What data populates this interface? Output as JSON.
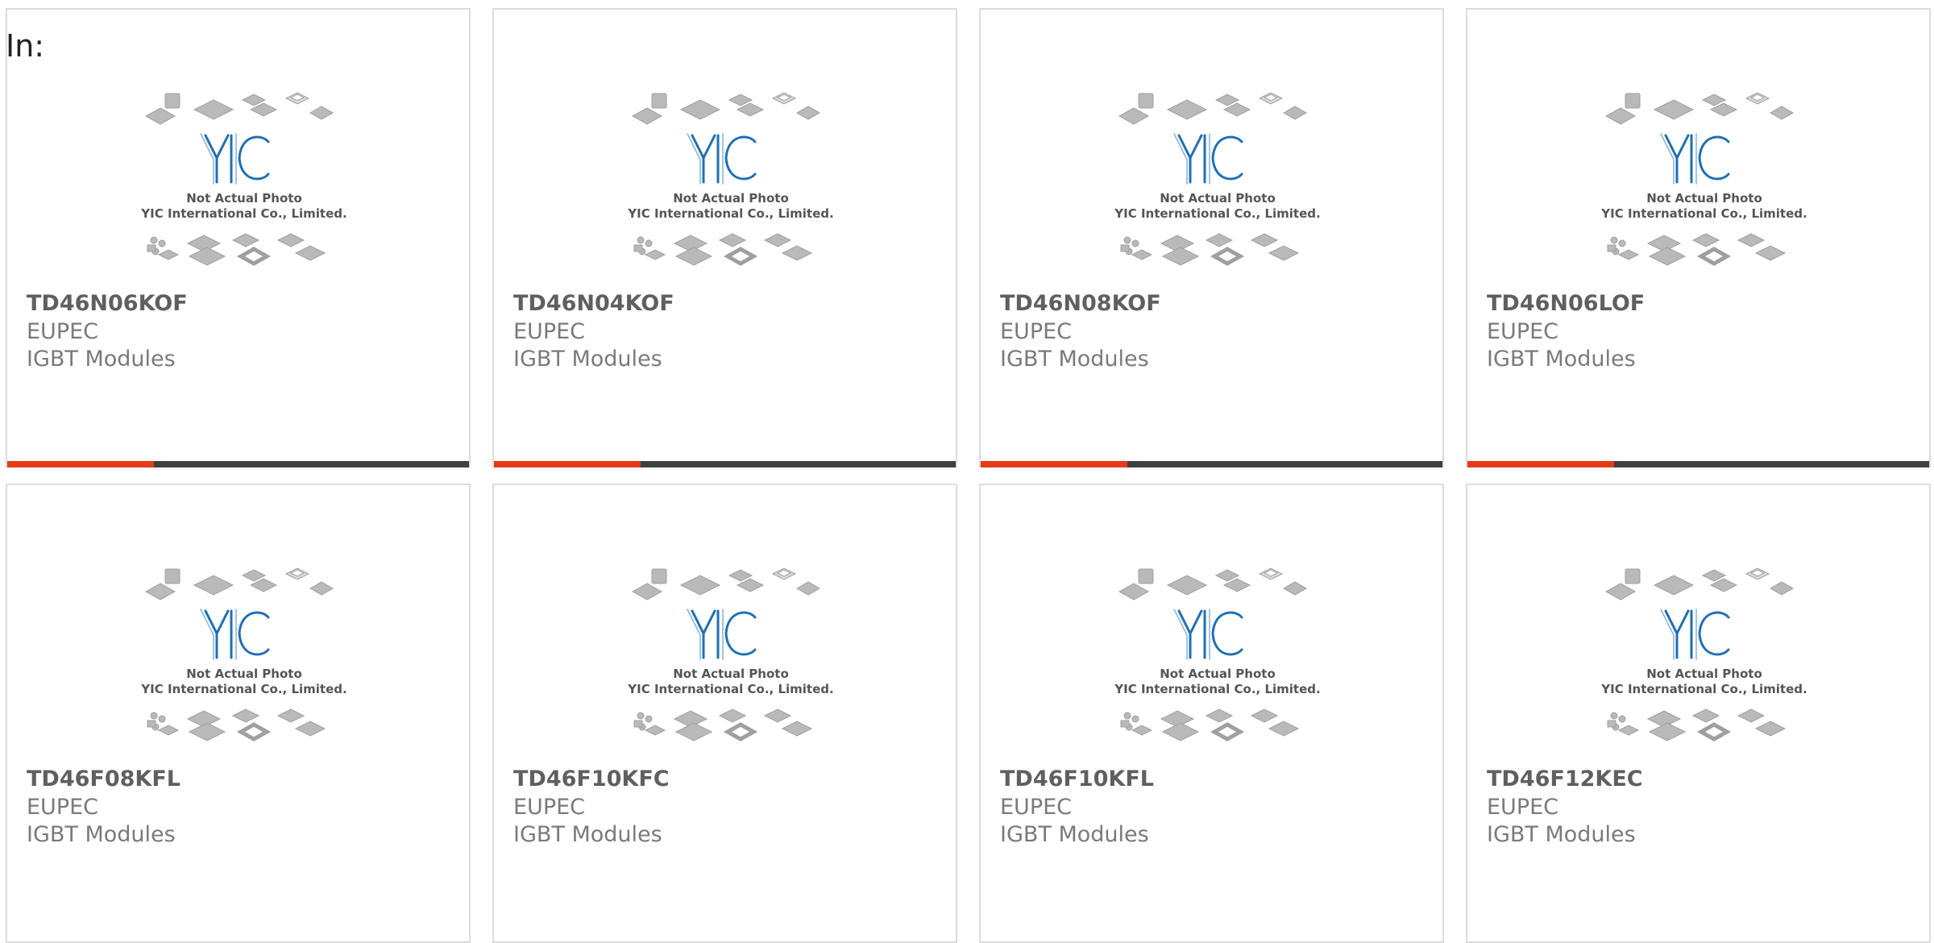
{
  "header": {
    "label": "In:"
  },
  "colors": {
    "accent": "#e53a17",
    "bar": "#3f3f3f",
    "logo_blue": "#1f6fb5",
    "chip_gray": "#b5b5b5"
  },
  "placeholder": {
    "line1": "Not Actual Photo",
    "line2": "YIC International Co., Limited.",
    "logo_text": "YIC"
  },
  "products": [
    {
      "part_number": "TD46N06KOF",
      "manufacturer": "EUPEC",
      "category": "IGBT Modules"
    },
    {
      "part_number": "TD46N04KOF",
      "manufacturer": "EUPEC",
      "category": "IGBT Modules"
    },
    {
      "part_number": "TD46N08KOF",
      "manufacturer": "EUPEC",
      "category": "IGBT Modules"
    },
    {
      "part_number": "TD46N06LOF",
      "manufacturer": "EUPEC",
      "category": "IGBT Modules"
    },
    {
      "part_number": "TD46F08KFL",
      "manufacturer": "EUPEC",
      "category": "IGBT Modules"
    },
    {
      "part_number": "TD46F10KFC",
      "manufacturer": "EUPEC",
      "category": "IGBT Modules"
    },
    {
      "part_number": "TD46F10KFL",
      "manufacturer": "EUPEC",
      "category": "IGBT Modules"
    },
    {
      "part_number": "TD46F12KEC",
      "manufacturer": "EUPEC",
      "category": "IGBT Modules"
    }
  ]
}
